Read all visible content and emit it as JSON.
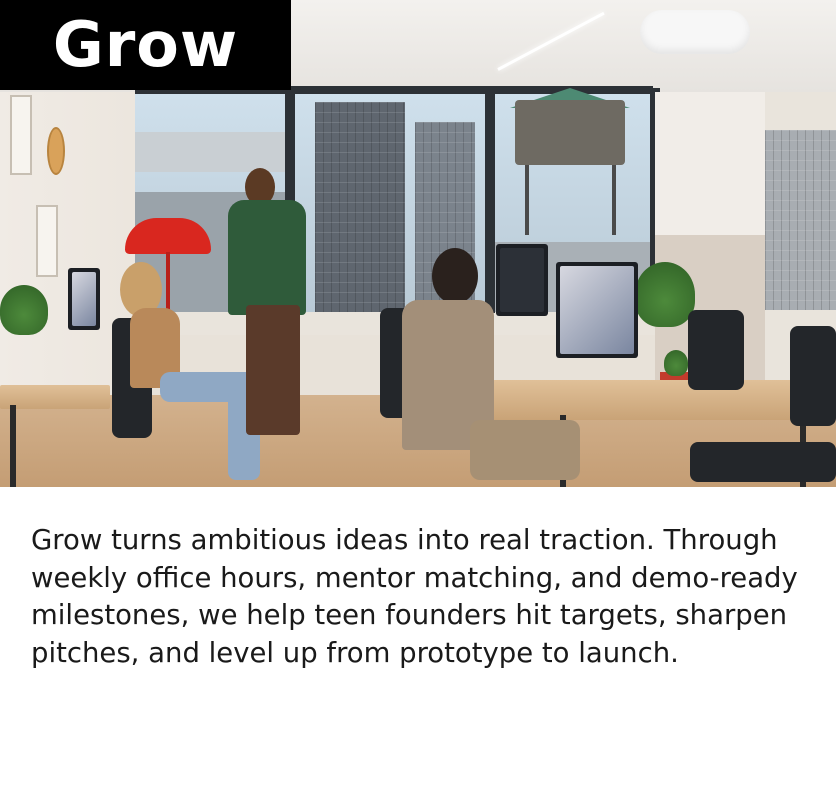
{
  "card": {
    "title": "Grow",
    "description": "Grow turns ambitious ideas into real traction. Through weekly office hours, mentor matching, and demo-ready milestones, we help teen founders hit targets, sharpen pitches, and level up from prototype to launch.",
    "colors": {
      "banner_background": "#000000",
      "banner_text": "#ffffff",
      "body_text": "#1a1a1a",
      "page_background": "#ffffff"
    },
    "photo": {
      "icon": "office-photo-icon"
    }
  }
}
